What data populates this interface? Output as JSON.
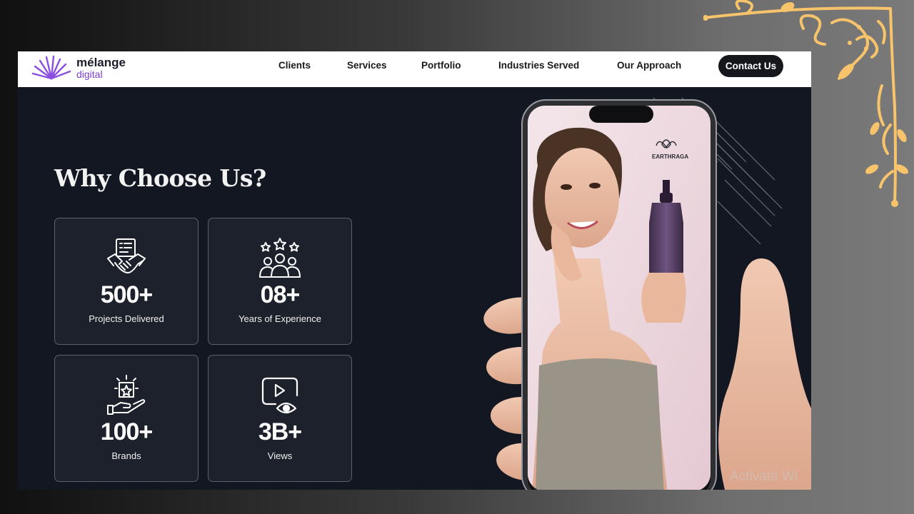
{
  "brand": {
    "name": "mélange",
    "subname": "digital",
    "accent": "#7b3fd6"
  },
  "nav": {
    "links": [
      {
        "label": "Clients"
      },
      {
        "label": "Services"
      },
      {
        "label": "Portfolio"
      },
      {
        "label": "Industries Served"
      },
      {
        "label": "Our Approach"
      }
    ],
    "contact_label": "Contact Us"
  },
  "hero": {
    "title": "Why Choose Us?"
  },
  "stats": [
    {
      "value": "500+",
      "label": "Projects Delivered",
      "icon": "handshake-contract-icon"
    },
    {
      "value": "08+",
      "label": "Years of Experience",
      "icon": "team-stars-icon"
    },
    {
      "value": "100+",
      "label": "Brands",
      "icon": "hand-star-box-icon"
    },
    {
      "value": "3B+",
      "label": "Views",
      "icon": "video-eye-icon"
    }
  ],
  "phone": {
    "product_brand": "EARTHRAGA"
  },
  "overlay": {
    "watermark": "Activate Wi"
  },
  "colors": {
    "page_dark": "#131722",
    "card_bg": "#1d212b",
    "ornament": "#f7c46c",
    "button_bg": "#15171d"
  }
}
